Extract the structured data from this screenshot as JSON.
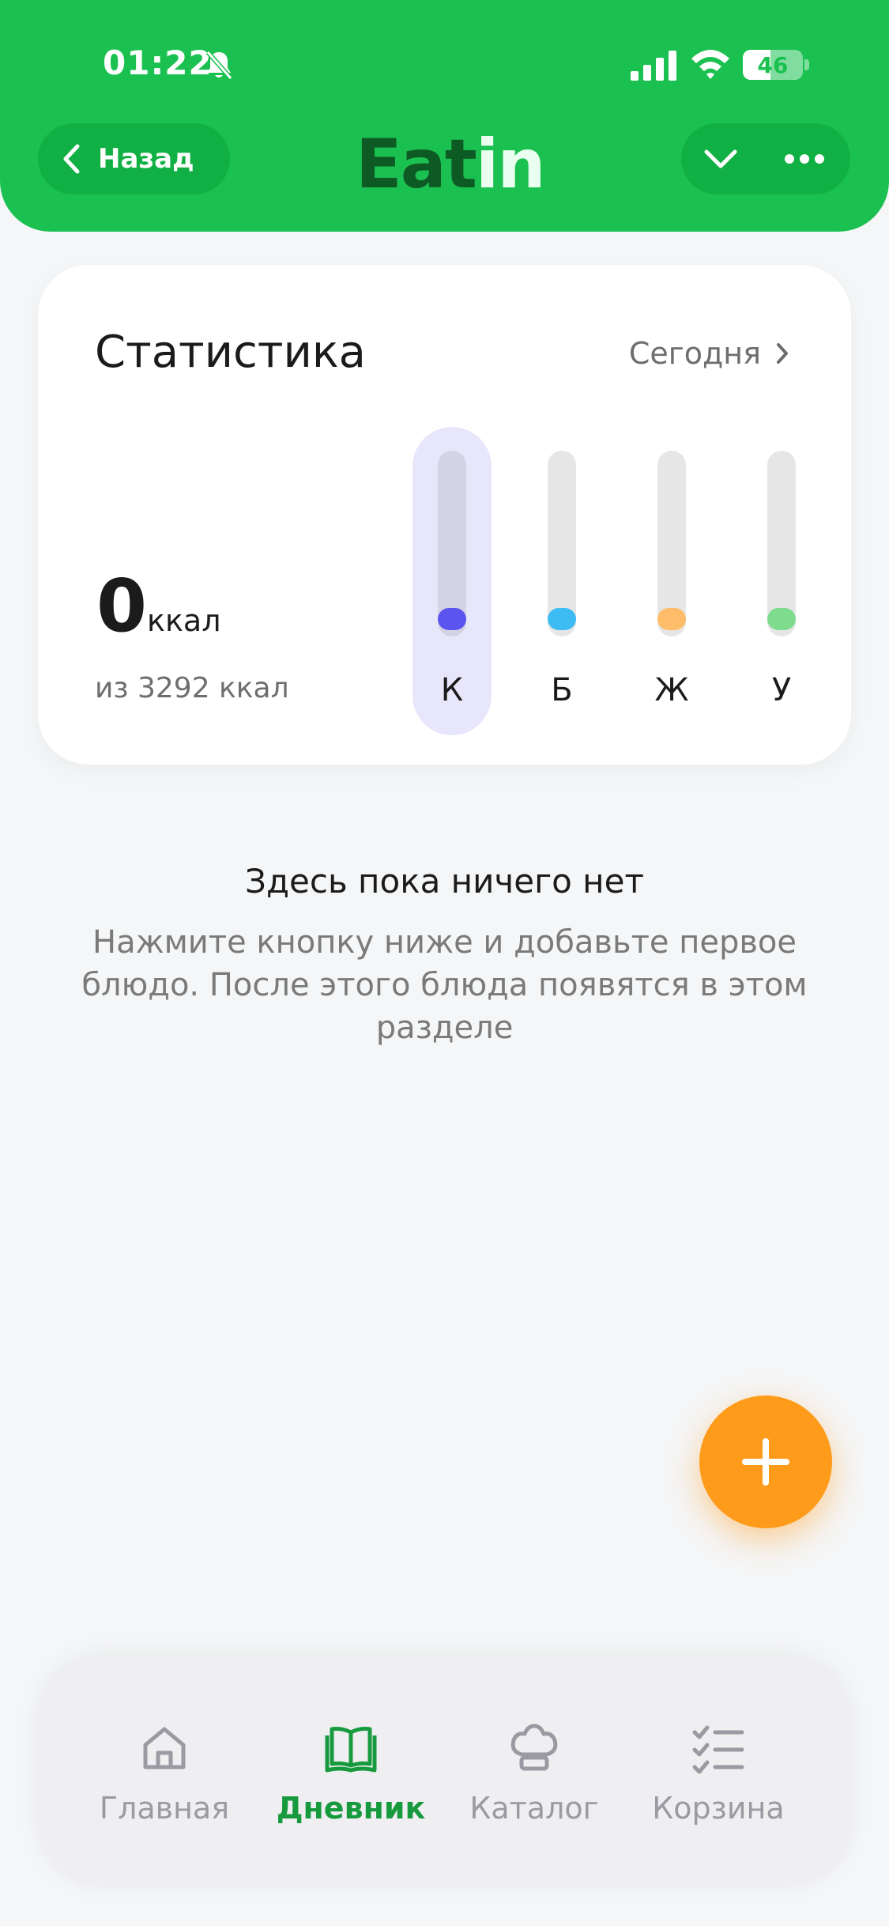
{
  "status_bar": {
    "time": "01:22",
    "battery": "46",
    "battery_level": 0.46
  },
  "header": {
    "back_label": "Назад",
    "logo_part1": "Eat",
    "logo_part2": "in",
    "colors": {
      "background": "#1bc150",
      "pill": "#11b044",
      "logo_dark": "#0e5a25"
    }
  },
  "stats": {
    "title": "Статистика",
    "period": "Сегодня",
    "kcal_value": "0",
    "kcal_unit": "ккал",
    "kcal_goal": "из 3292 ккал",
    "bars": [
      {
        "label": "К",
        "color": "#5b54f0",
        "active": true,
        "progress": 0
      },
      {
        "label": "Б",
        "color": "#3cbcf2",
        "active": false,
        "progress": 0
      },
      {
        "label": "Ж",
        "color": "#ffbd6a",
        "active": false,
        "progress": 0
      },
      {
        "label": "У",
        "color": "#7edc8f",
        "active": false,
        "progress": 0
      }
    ]
  },
  "empty_state": {
    "title": "Здесь пока ничего нет",
    "description": "Нажмите кнопку ниже и добавьте первое блюдо. После этого блюда появятся в этом разделе"
  },
  "fab": {
    "icon": "plus-icon",
    "color": "#ff9b1a"
  },
  "bottom_nav": {
    "items": [
      {
        "label": "Главная",
        "icon": "home-icon",
        "active": false
      },
      {
        "label": "Дневник",
        "icon": "book-icon",
        "active": true
      },
      {
        "label": "Каталог",
        "icon": "chef-hat-icon",
        "active": false
      },
      {
        "label": "Корзина",
        "icon": "checklist-icon",
        "active": false
      }
    ],
    "active_color": "#179a3e",
    "inactive_color": "#9a9aa2"
  }
}
